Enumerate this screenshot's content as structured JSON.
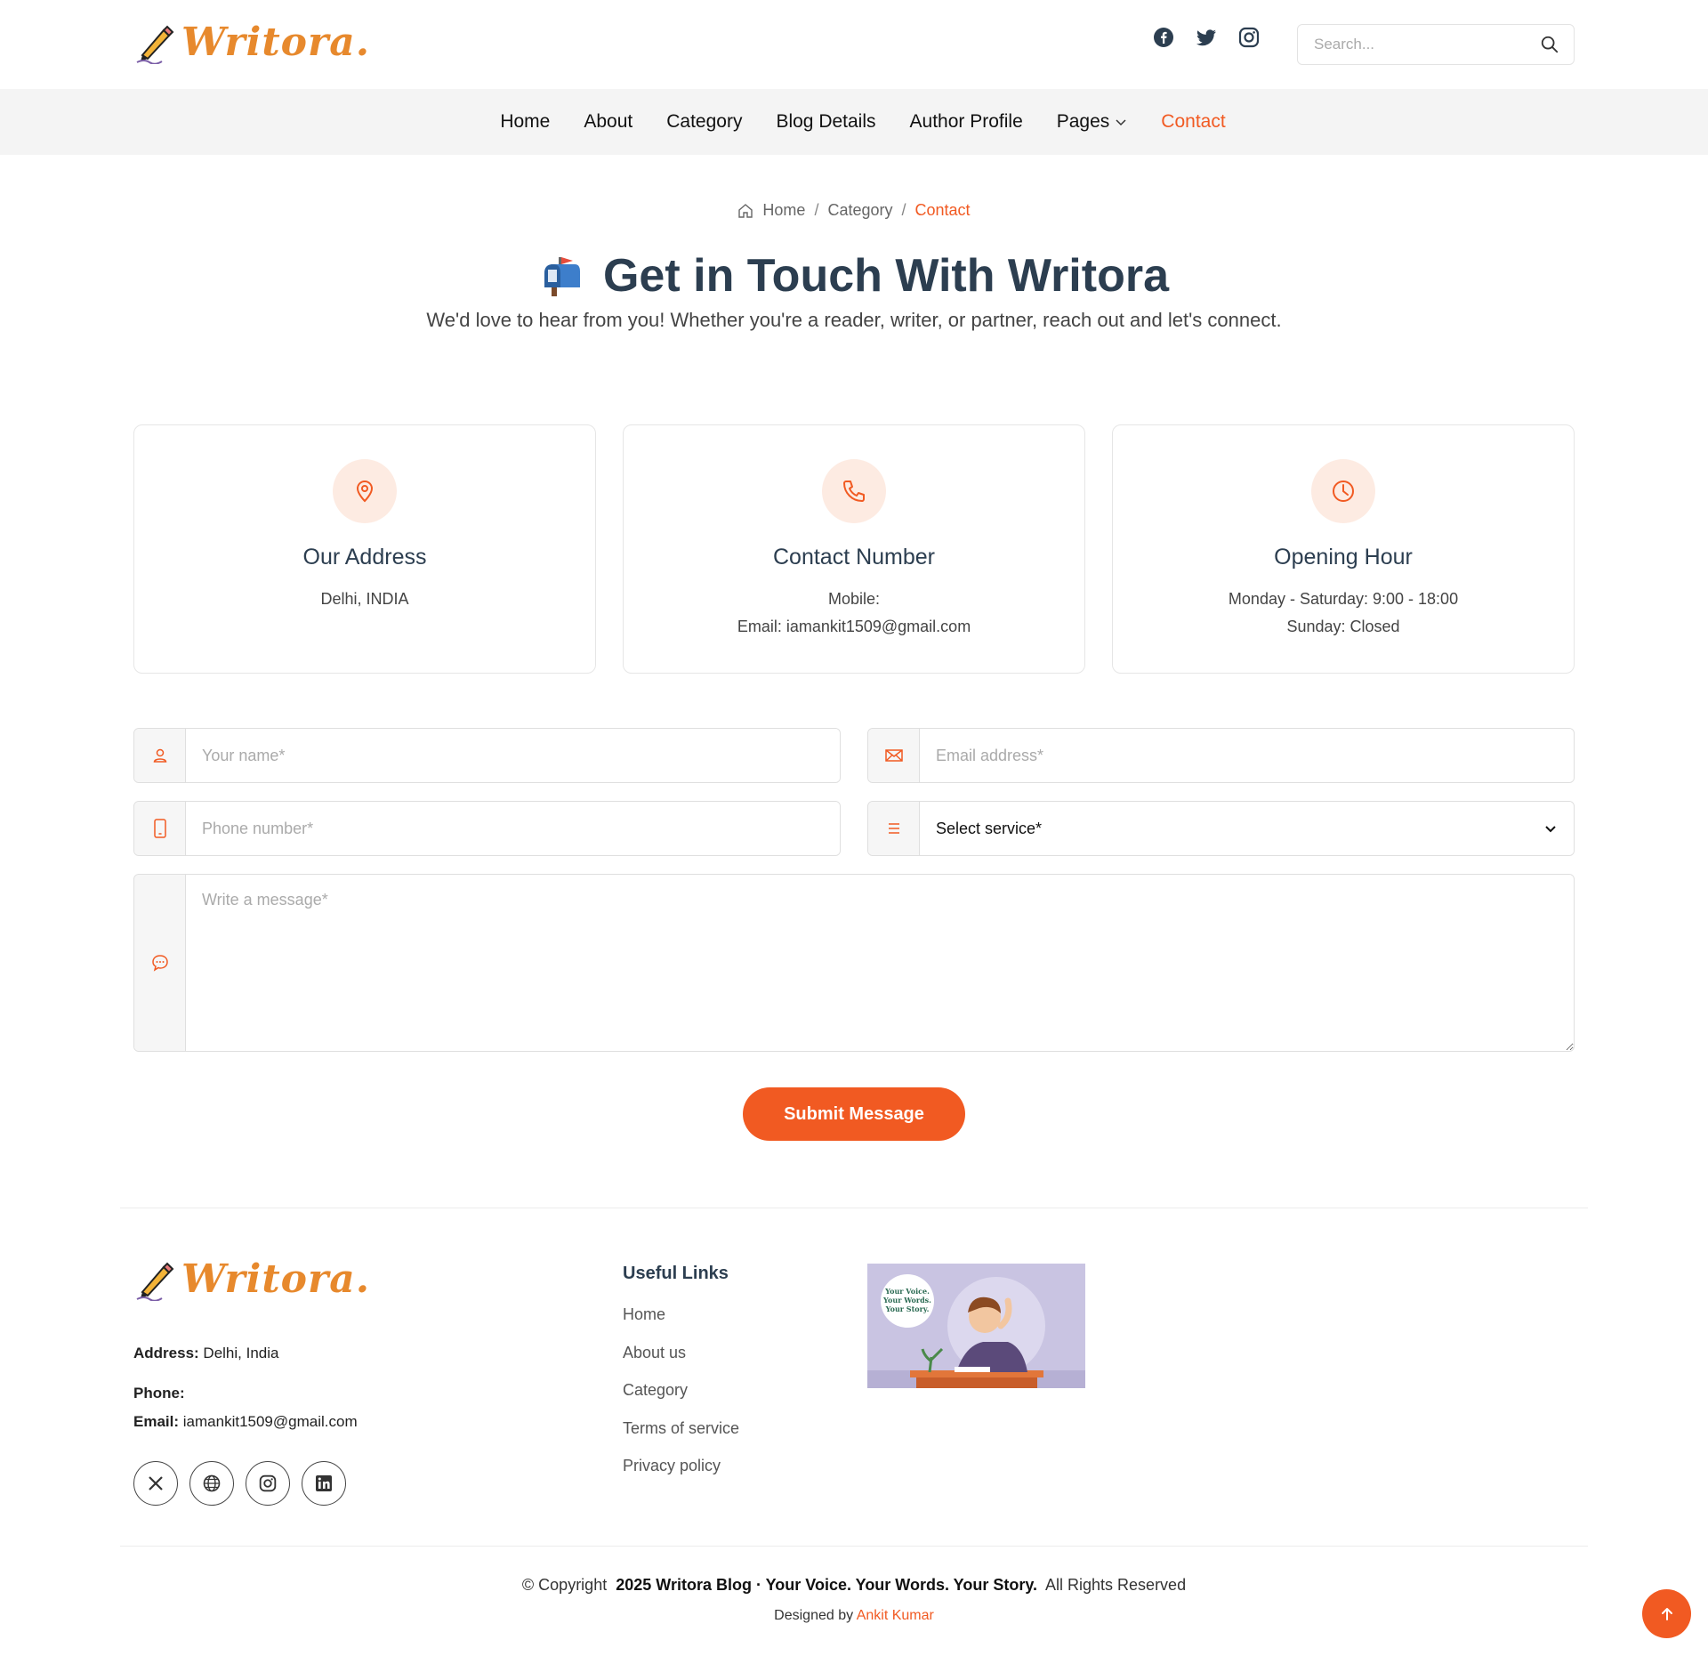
{
  "brand": {
    "name": "Writora."
  },
  "search": {
    "placeholder": "Search..."
  },
  "nav": {
    "items": [
      {
        "label": "Home"
      },
      {
        "label": "About"
      },
      {
        "label": "Category"
      },
      {
        "label": "Blog Details"
      },
      {
        "label": "Author Profile"
      },
      {
        "label": "Pages"
      },
      {
        "label": "Contact"
      }
    ]
  },
  "breadcrumb": {
    "home": "Home",
    "category": "Category",
    "current": "Contact",
    "separator": "/"
  },
  "hero": {
    "title": "Get in Touch With Writora",
    "subtitle": "We'd love to hear from you! Whether you're a reader, writer, or partner, reach out and let's connect."
  },
  "cards": {
    "address": {
      "title": "Our Address",
      "line1": "Delhi, INDIA"
    },
    "contact": {
      "title": "Contact Number",
      "line1": "Mobile:",
      "line2": "Email: iamankit1509@gmail.com"
    },
    "hours": {
      "title": "Opening Hour",
      "line1": "Monday - Saturday: 9:00 - 18:00",
      "line2": "Sunday: Closed"
    }
  },
  "form": {
    "name_placeholder": "Your name*",
    "email_placeholder": "Email address*",
    "phone_placeholder": "Phone number*",
    "service_selected": "Select service*",
    "message_placeholder": "Write a message*",
    "submit_label": "Submit Message"
  },
  "footer": {
    "address_label": "Address:",
    "address_value": "Delhi, India",
    "phone_label": "Phone:",
    "email_label": "Email:",
    "email_value": "iamankit1509@gmail.com",
    "links_title": "Useful Links",
    "links": [
      "Home",
      "About us",
      "Category",
      "Terms of service",
      "Privacy policy"
    ],
    "image_text": [
      "Your Voice.",
      "Your Words.",
      "Your Story."
    ],
    "copyright_prefix": "© Copyright",
    "copyright_bold": "2025 Writora Blog · Your Voice. Your Words. Your Story.",
    "copyright_suffix": "All Rights Reserved",
    "designed_prefix": "Designed by",
    "designer": "Ankit Kumar"
  },
  "colors": {
    "accent": "#f15a22",
    "brand": "#e7892d",
    "heading": "#2c3e50"
  }
}
